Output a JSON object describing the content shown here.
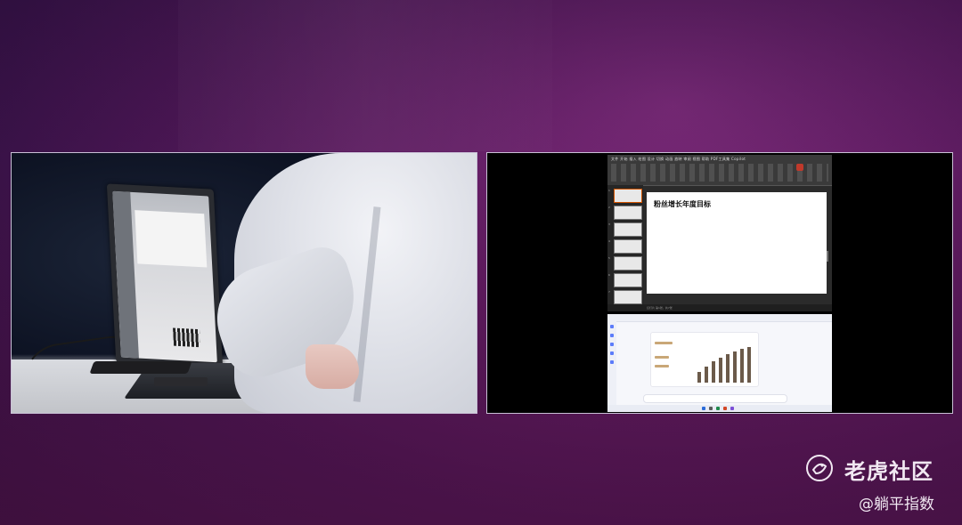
{
  "left_panel": {
    "kind": "presenter camera view"
  },
  "right_panel": {
    "powerpoint": {
      "ribbon_tabs": "文件 开始 插入 绘图 设计 切换 动画 放映 审阅 视图 帮助 PDF工具集 Copilot",
      "thumbnails": [
        "1",
        "2",
        "3",
        "4",
        "5",
        "6",
        "7"
      ],
      "slide_title": "粉丝增长年度目标",
      "status_text": "幻灯片 第1张，共7张"
    },
    "chat": {
      "mini_bars": [
        0.28,
        0.42,
        0.55,
        0.64,
        0.72,
        0.8,
        0.86,
        0.9
      ]
    }
  },
  "watermark": {
    "brand": "老虎社区",
    "author": "@躺平指数"
  },
  "colors": {
    "bg_purple": "#5a1a5e",
    "ppt_dark": "#2b2b2b",
    "accent_red": "#c0392b",
    "chart_brown": "#6b5a4a"
  }
}
